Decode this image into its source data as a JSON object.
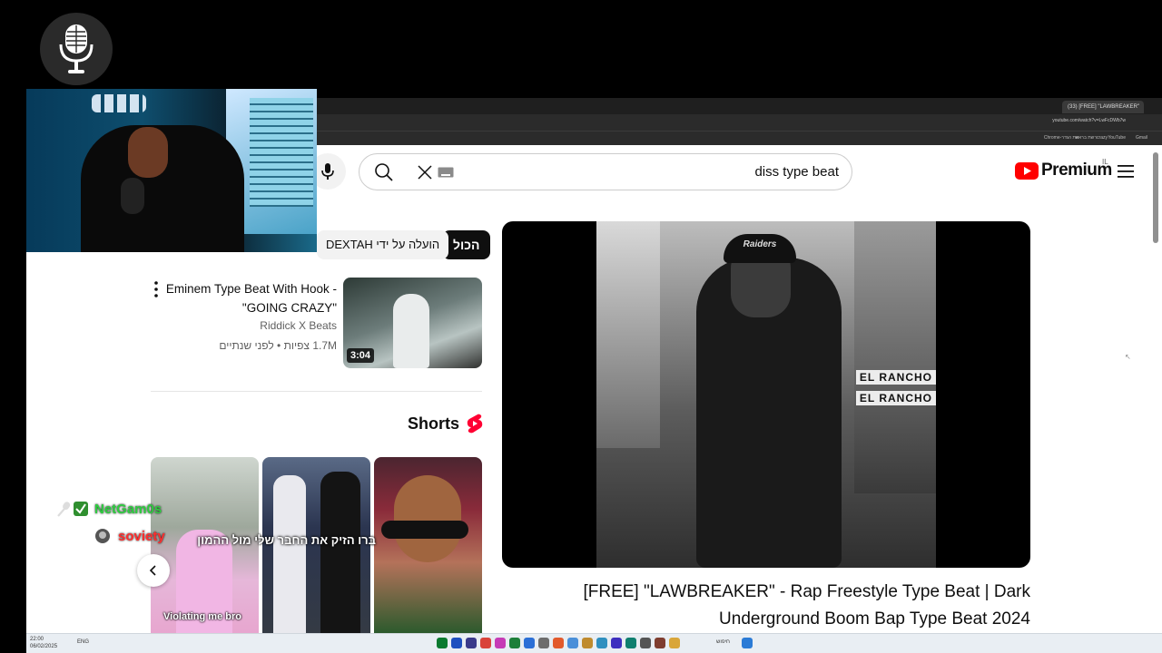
{
  "overlay": {
    "logo_icon": "microphone-icon",
    "chat": [
      {
        "name": "NetGam0s",
        "badges": [
          "microphone-icon",
          "badge-icon"
        ],
        "color": "#2ecc40"
      },
      {
        "name": "soviety",
        "badges": [
          "badge-icon"
        ],
        "color": "#ff2e2e"
      }
    ]
  },
  "browser": {
    "tab_label": "(33) [FREE] \"LAWBREAKER\"",
    "url": "youtube.com/watch?v=LwFcDWb7w",
    "bookmarks": [
      "Chrome-את הגדר",
      "רשת בראש",
      "crazy",
      "YouTube",
      "Gmail"
    ]
  },
  "youtube": {
    "search": {
      "value": "diss type beat"
    },
    "logo_text": "Premium",
    "country": "IL",
    "chips": {
      "all": "הכול",
      "uploaded_by": "הועלה על ידי DEXTAH"
    },
    "video_result": {
      "title": "Eminem Type Beat With Hook - \"GOING CRAZY\"",
      "channel": "Riddick X Beats",
      "meta": "1.7M צפיות • לפני שנתיים",
      "duration": "3:04"
    },
    "shorts": {
      "label": "Shorts",
      "items": [
        {
          "caption": "Violating me bro"
        },
        {
          "caption": "ברו הזיק את החבר שלי מול ההמון"
        },
        {
          "caption": ""
        }
      ]
    },
    "player": {
      "sign_1": "EL RANCHO",
      "sign_2": "EL RANCHO",
      "cap_text": "Raiders"
    },
    "now_playing_title": "[FREE] \"LAWBREAKER\" - Rap Freestyle Type Beat | Dark Underground Boom Bap Type Beat 2024"
  },
  "taskbar": {
    "time": "22:00",
    "date": "06/02/2025",
    "lang": "ENG",
    "search_placeholder": "חיפוש"
  },
  "colors": {
    "youtube_red": "#ff0000",
    "shorts_red": "#ff0033",
    "chip_active": "#0f0f0f"
  }
}
